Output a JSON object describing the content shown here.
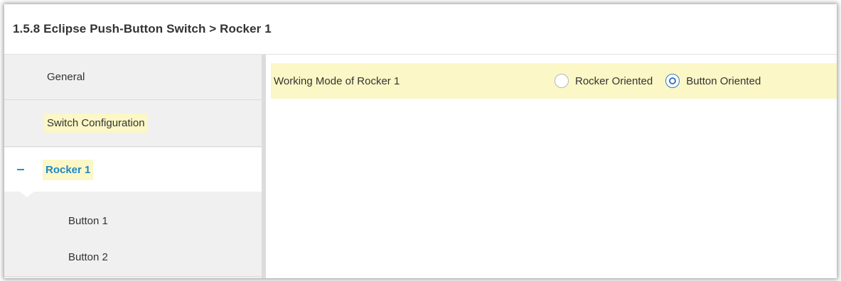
{
  "header": {
    "title": "1.5.8 Eclipse Push-Button Switch > Rocker 1"
  },
  "sidebar": {
    "items": [
      {
        "label": "General"
      },
      {
        "label": "Switch Configuration"
      },
      {
        "label": "Rocker 1",
        "expanded": true,
        "collapse_symbol": "–"
      }
    ],
    "subitems": [
      {
        "label": "Button 1"
      },
      {
        "label": "Button 2"
      }
    ]
  },
  "main": {
    "param": {
      "label": "Working Mode of Rocker 1",
      "options": [
        {
          "label": "Rocker Oriented",
          "selected": false
        },
        {
          "label": "Button Oriented",
          "selected": true
        }
      ]
    }
  },
  "colors": {
    "highlight": "#fbf7c6",
    "accent": "#1f86c8",
    "sidebar_bg": "#f0f0f0",
    "radio_selected": "#3a78c2"
  }
}
